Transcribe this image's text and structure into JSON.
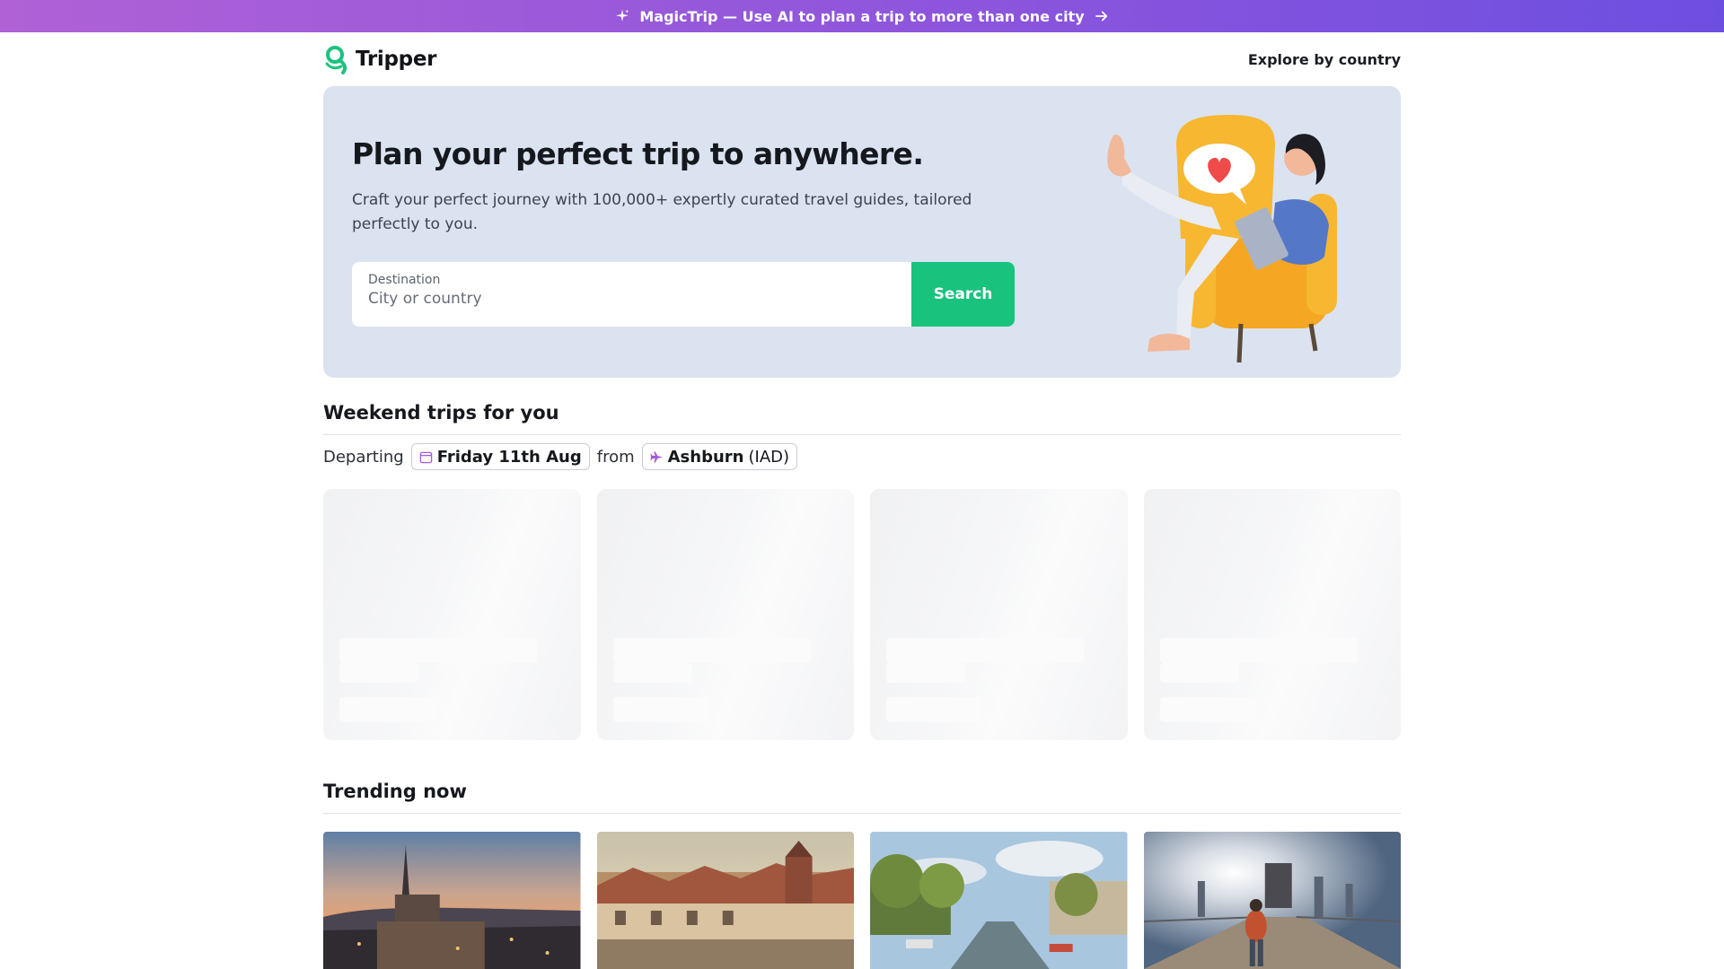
{
  "banner": {
    "text": "MagicTrip — Use AI to plan a trip to more than one city",
    "icon": "sparkle-icon",
    "arrow_icon": "arrow-right-icon"
  },
  "header": {
    "brand": "Tripper",
    "explore_link": "Explore by country"
  },
  "hero": {
    "title": "Plan your perfect trip to anywhere.",
    "subtitle": "Craft your perfect journey with 100,000+ expertly curated travel guides, tailored perfectly to you.",
    "destination_label": "Destination",
    "destination_placeholder": "City or country",
    "search_button": "Search"
  },
  "weekend": {
    "title": "Weekend trips for you",
    "departing_label": "Departing",
    "date": "Friday 11th Aug",
    "from_label": "from",
    "origin_city": "Ashburn",
    "origin_code": "(IAD)"
  },
  "trending": {
    "title": "Trending now"
  },
  "colors": {
    "banner_start": "#b061d6",
    "banner_end": "#6d4fe0",
    "brand_green": "#19c37d",
    "hero_bg": "#dbe3f1"
  }
}
